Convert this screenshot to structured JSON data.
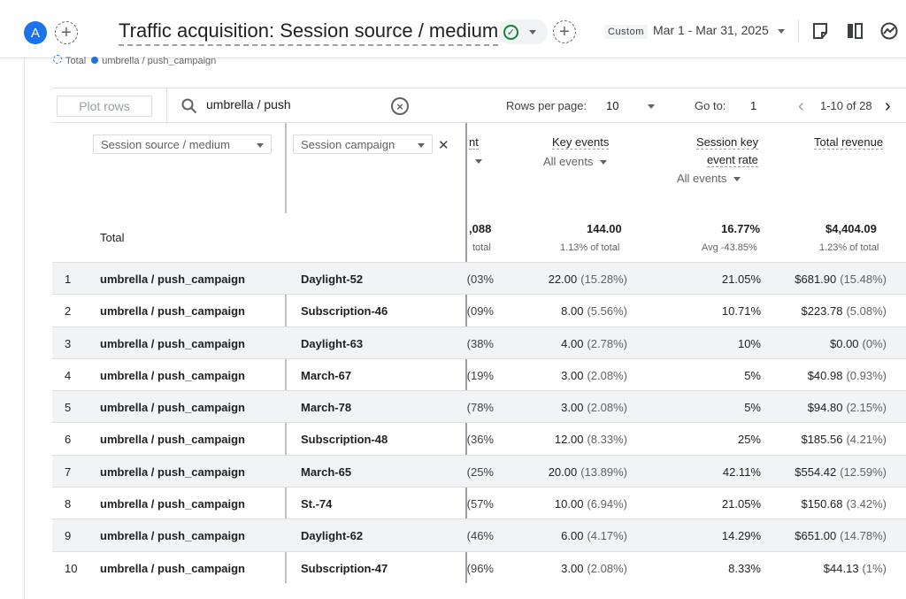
{
  "header": {
    "avatar_letter": "A",
    "title": "Traffic acquisition: Session source / medium",
    "custom_label": "Custom",
    "date_range": "Mar 1 - Mar 31, 2025"
  },
  "legend": {
    "total": "Total",
    "series": "umbrella / push_campaign"
  },
  "toolbar": {
    "plot_rows": "Plot rows",
    "search_value": "umbrella / push",
    "rows_per_page_label": "Rows per page:",
    "rows_per_page_value": "10",
    "goto_label": "Go to:",
    "goto_value": "1",
    "page_range": "1-10 of 28"
  },
  "columns": {
    "dim1": "Session source / medium",
    "dim2": "Session campaign",
    "clipped_metric": "nt",
    "key_events": "Key events",
    "key_events_filter": "All events",
    "ske_rate_line1": "Session key",
    "ske_rate_line2": "event rate",
    "ske_rate_filter": "All events",
    "total_revenue": "Total revenue"
  },
  "totals": {
    "label": "Total",
    "clipped_value": ",088",
    "clipped_sub": "total",
    "key_events": "144.00",
    "key_events_sub": "1.13% of total",
    "ske_rate": "16.77%",
    "ske_rate_sub": "Avg -43.85%",
    "revenue": "$4,404.09",
    "revenue_sub": "1.23% of total"
  },
  "rows": [
    {
      "num": "1",
      "source": "umbrella / push_campaign",
      "campaign": "Daylight-52",
      "cut": "03%)",
      "ke": "22.00",
      "ke_pct": "(15.28%)",
      "rate": "21.05%",
      "rev": "$681.90",
      "rev_pct": "(15.48%)"
    },
    {
      "num": "2",
      "source": "umbrella / push_campaign",
      "campaign": "Subscription-46",
      "cut": "09%)",
      "ke": "8.00",
      "ke_pct": "(5.56%)",
      "rate": "10.71%",
      "rev": "$223.78",
      "rev_pct": "(5.08%)"
    },
    {
      "num": "3",
      "source": "umbrella / push_campaign",
      "campaign": "Daylight-63",
      "cut": "38%)",
      "ke": "4.00",
      "ke_pct": "(2.78%)",
      "rate": "10%",
      "rev": "$0.00",
      "rev_pct": "(0%)"
    },
    {
      "num": "4",
      "source": "umbrella / push_campaign",
      "campaign": "March-67",
      "cut": "19%)",
      "ke": "3.00",
      "ke_pct": "(2.08%)",
      "rate": "5%",
      "rev": "$40.98",
      "rev_pct": "(0.93%)"
    },
    {
      "num": "5",
      "source": "umbrella / push_campaign",
      "campaign": "March-78",
      "cut": "78%)",
      "ke": "3.00",
      "ke_pct": "(2.08%)",
      "rate": "5%",
      "rev": "$94.80",
      "rev_pct": "(2.15%)"
    },
    {
      "num": "6",
      "source": "umbrella / push_campaign",
      "campaign": "Subscription-48",
      "cut": "36%)",
      "ke": "12.00",
      "ke_pct": "(8.33%)",
      "rate": "25%",
      "rev": "$185.56",
      "rev_pct": "(4.21%)"
    },
    {
      "num": "7",
      "source": "umbrella / push_campaign",
      "campaign": "March-65",
      "cut": "25%)",
      "ke": "20.00",
      "ke_pct": "(13.89%)",
      "rate": "42.11%",
      "rev": "$554.42",
      "rev_pct": "(12.59%)"
    },
    {
      "num": "8",
      "source": "umbrella / push_campaign",
      "campaign": "St.-74",
      "cut": "57%)",
      "ke": "10.00",
      "ke_pct": "(6.94%)",
      "rate": "21.05%",
      "rev": "$150.68",
      "rev_pct": "(3.42%)"
    },
    {
      "num": "9",
      "source": "umbrella / push_campaign",
      "campaign": "Daylight-62",
      "cut": "46%)",
      "ke": "6.00",
      "ke_pct": "(4.17%)",
      "rate": "14.29%",
      "rev": "$651.00",
      "rev_pct": "(14.78%)"
    },
    {
      "num": "10",
      "source": "umbrella / push_campaign",
      "campaign": "Subscription-47",
      "cut": "96%)",
      "ke": "3.00",
      "ke_pct": "(2.08%)",
      "rate": "8.33%",
      "rev": "$44.13",
      "rev_pct": "(1%)"
    }
  ]
}
